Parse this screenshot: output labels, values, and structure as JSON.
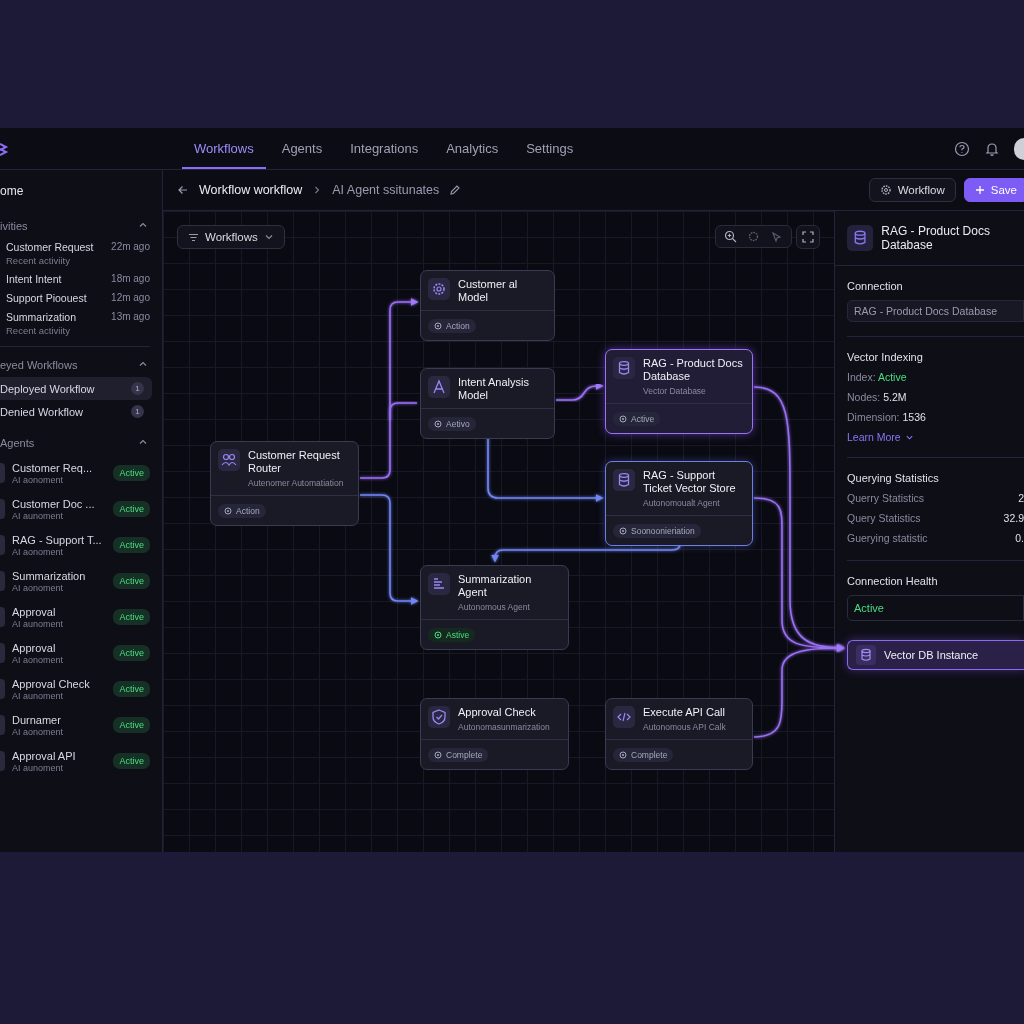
{
  "nav": {
    "tabs": [
      {
        "label": "Workflows",
        "selected": true
      },
      {
        "label": "Agents",
        "selected": false
      },
      {
        "label": "Integrations",
        "selected": false
      },
      {
        "label": "Analytics",
        "selected": false
      },
      {
        "label": "Settings",
        "selected": false
      }
    ]
  },
  "sidebar": {
    "home": "ome",
    "activities": {
      "title": "ivities",
      "expanded": true,
      "items": [
        {
          "title": "Customer Request",
          "subtitle": "Recent activiity",
          "time": "22m ago"
        },
        {
          "title": "Intent Intent",
          "time": "18m ago"
        },
        {
          "title": "Support Pioouest",
          "time": "12m ago"
        },
        {
          "title": "Summarization",
          "subtitle": "Recent activiity",
          "time": "13m ago"
        }
      ]
    },
    "workflows": {
      "title": "eyed Workflows",
      "expanded": true,
      "items": [
        {
          "label": "Deployed Workflow",
          "count": "1",
          "selected": true
        },
        {
          "label": "Denied Workflow",
          "count": "1",
          "selected": false
        }
      ]
    },
    "agents": {
      "title": "Agents",
      "expanded": true,
      "items": [
        {
          "name": "Customer Req...",
          "subtitle": "AI aonoment",
          "status": "Active"
        },
        {
          "name": "Customer Doc ...",
          "subtitle": "AI aunoment",
          "status": "Active"
        },
        {
          "name": "RAG - Support T...",
          "subtitle": "AI aonoment",
          "status": "Active"
        },
        {
          "name": "Summarization",
          "subtitle": "AI aonoment",
          "status": "Active"
        },
        {
          "name": "Approval",
          "subtitle": "AI aunoment",
          "status": "Active"
        },
        {
          "name": "Approval",
          "subtitle": "AI aonoment",
          "status": "Active"
        },
        {
          "name": "Approval Check",
          "subtitle": "AI aunoment",
          "status": "Active"
        },
        {
          "name": "Durnamer",
          "subtitle": "AI aonoment",
          "status": "Active"
        },
        {
          "name": "Approval API",
          "subtitle": "AI aunoment",
          "status": "Active"
        }
      ]
    }
  },
  "breadcrumb": {
    "parent": "Workflow workflow",
    "current": "AI Agent ssitunates"
  },
  "actions": {
    "workflow": "Workflow",
    "save": "Save"
  },
  "canvas": {
    "filter": "Workflows",
    "nodes": [
      {
        "title": "Customer Request Router",
        "subtitle": "Autenomer Automatiation",
        "selected": false,
        "linked": false,
        "status": {
          "label": "Action",
          "kind": "neutral"
        }
      },
      {
        "title": "Customer al Model",
        "selected": false,
        "linked": false,
        "status": {
          "label": "Action",
          "kind": "neutral"
        }
      },
      {
        "title": "Intent Analysis Model",
        "selected": false,
        "linked": false,
        "status": {
          "label": "Aetivo",
          "kind": "neutral"
        }
      },
      {
        "title": "RAG - Product Docs Database",
        "subtitle": "Vector Database",
        "selected": true,
        "linked": false,
        "status": {
          "label": "Active",
          "kind": "neutral"
        }
      },
      {
        "title": "RAG - Support Ticket Vector Store",
        "subtitle": "Autonomoualt Agent",
        "selected": false,
        "linked": true,
        "status": {
          "label": "Soonoonieriation",
          "kind": "neutral"
        }
      },
      {
        "title": "Summarization Agent",
        "subtitle": "Autonomous Agent",
        "selected": false,
        "linked": false,
        "status": {
          "label": "Astive",
          "kind": "success"
        }
      },
      {
        "title": "Approval Check",
        "subtitle": "Autonomasunmarization",
        "selected": false,
        "linked": false,
        "status": {
          "label": "Complete",
          "kind": "neutral"
        }
      },
      {
        "title": "Execute API Call",
        "subtitle": "Autonomous API Calk",
        "selected": false,
        "linked": false,
        "status": {
          "label": "Complete",
          "kind": "neutral"
        }
      }
    ]
  },
  "panel": {
    "title": "RAG - Product Docs Database",
    "connection": {
      "label": "Connection",
      "value": "RAG - Product Docs  Database"
    },
    "indexing": {
      "title": "Vector Indexing",
      "rows": [
        {
          "label": "Index:",
          "value": "Active",
          "kind": "status"
        },
        {
          "label": "Nodes:",
          "value": "5.2M",
          "kind": "plain"
        },
        {
          "label": "Dimension:",
          "value": "1536",
          "kind": "plain"
        }
      ],
      "link": "Learn More"
    },
    "stats": {
      "title": "Querying Statistics",
      "rows": [
        {
          "label": "Querry Statistics",
          "value": "2"
        },
        {
          "label": "Query Statistics",
          "value": "32.9"
        },
        {
          "label": "Guerying statistic",
          "value": "0."
        }
      ]
    },
    "health": {
      "title": "Connection Health",
      "value": "Active"
    },
    "instance": "Vector DB Instance"
  }
}
